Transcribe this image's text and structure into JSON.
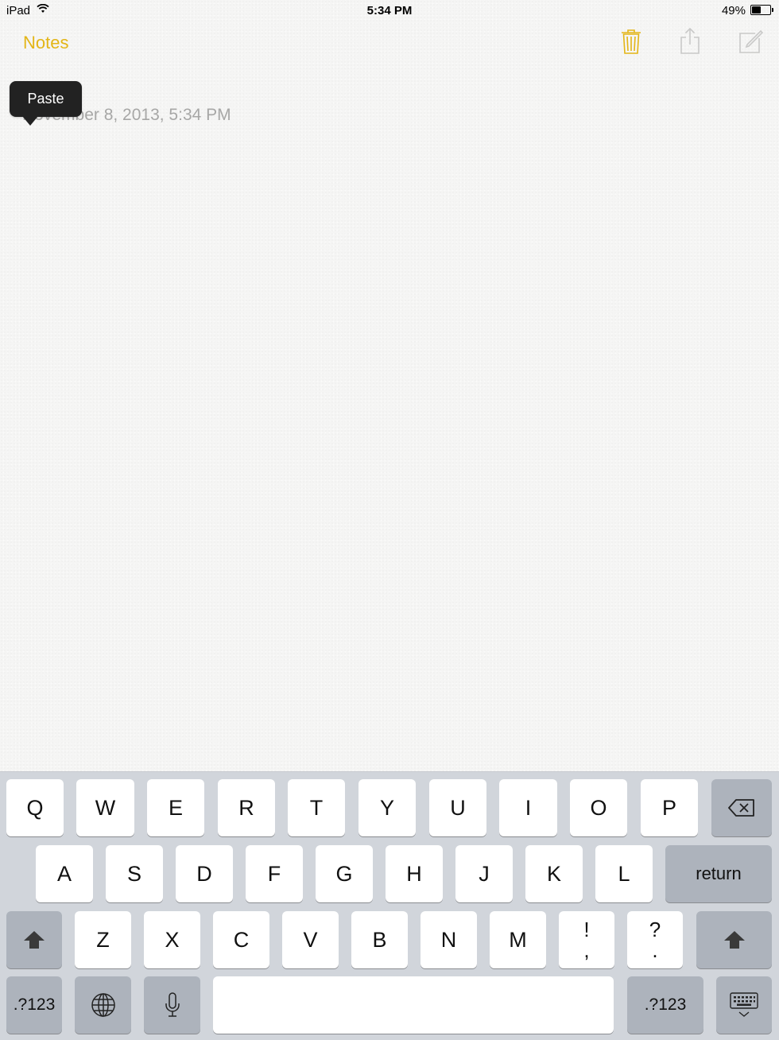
{
  "status_bar": {
    "carrier": "iPad",
    "time": "5:34 PM",
    "battery_percent": "49%",
    "battery_level": 0.49
  },
  "nav": {
    "back_label": "Notes",
    "accent_color": "#e3b516"
  },
  "note": {
    "date": "November 8, 2013, 5:34 PM"
  },
  "paste_menu": {
    "label": "Paste"
  },
  "keyboard": {
    "row1": [
      "Q",
      "W",
      "E",
      "R",
      "T",
      "Y",
      "U",
      "I",
      "O",
      "P"
    ],
    "row2": [
      "A",
      "S",
      "D",
      "F",
      "G",
      "H",
      "J",
      "K",
      "L"
    ],
    "row3": [
      "Z",
      "X",
      "C",
      "V",
      "B",
      "N",
      "M"
    ],
    "punct1": {
      "top": "!",
      "bottom": ","
    },
    "punct2": {
      "top": "?",
      "bottom": "."
    },
    "return_label": "return",
    "numbers_label": ".?123",
    "icons": {
      "backspace": "backspace-icon",
      "shift": "shift-icon",
      "globe": "globe-icon",
      "mic": "microphone-icon",
      "hide": "keyboard-hide-icon"
    }
  }
}
